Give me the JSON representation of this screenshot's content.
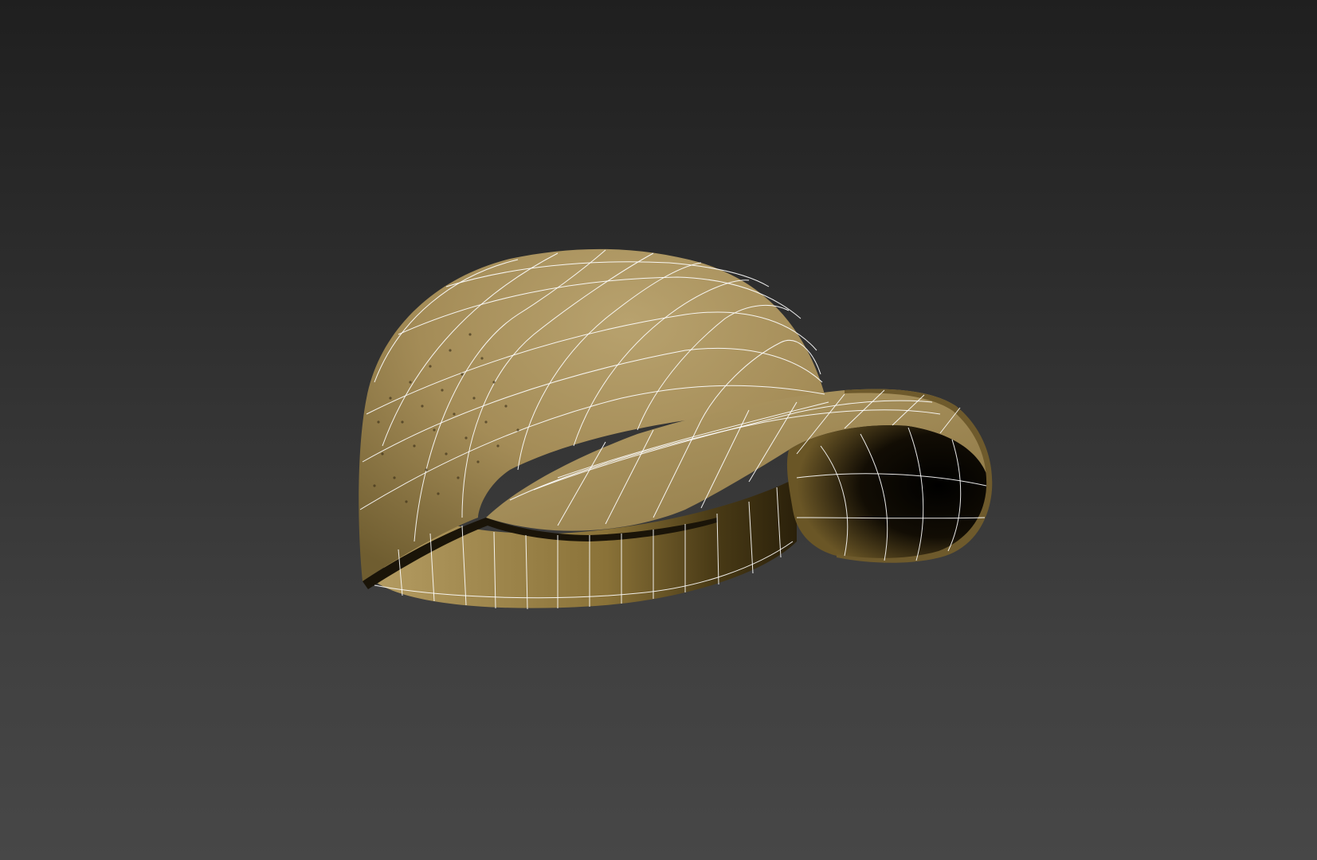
{
  "viewport": {
    "background_top": "#1f1f1f",
    "background_bottom": "#474747"
  },
  "model": {
    "object": "baseball-cap",
    "display_mode": "shaded-with-wireframe",
    "fill_light": "#b39c68",
    "fill_mid": "#9a8350",
    "fill_dark": "#5a4a24",
    "interior_dark": "#0a0804",
    "wire_color": "#ffffff"
  }
}
